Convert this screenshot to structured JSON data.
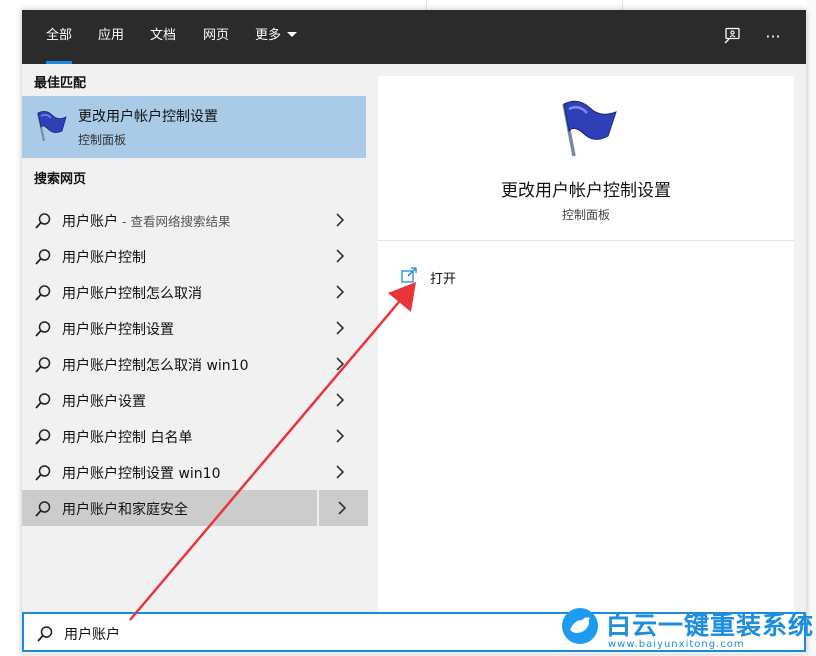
{
  "tabs": [
    {
      "label": "全部"
    },
    {
      "label": "应用"
    },
    {
      "label": "文档"
    },
    {
      "label": "网页"
    },
    {
      "label": "更多"
    }
  ],
  "top_icons": {
    "feedback": "feedback-icon",
    "more": "···"
  },
  "left": {
    "best_match_title": "最佳匹配",
    "best_match": {
      "title": "更改用户帐户控制设置",
      "subtitle": "控制面板",
      "icon": "flag-icon"
    },
    "web_title": "搜索网页",
    "web_results": [
      {
        "label": "用户账户",
        "hint": " - 查看网络搜索结果"
      },
      {
        "label": "用户账户控制",
        "hint": ""
      },
      {
        "label": "用户账户控制怎么取消",
        "hint": ""
      },
      {
        "label": "用户账户控制设置",
        "hint": ""
      },
      {
        "label": "用户账户控制怎么取消 win10",
        "hint": ""
      },
      {
        "label": "用户账户设置",
        "hint": ""
      },
      {
        "label": "用户账户控制 白名单",
        "hint": ""
      },
      {
        "label": "用户账户控制设置 win10",
        "hint": ""
      },
      {
        "label": "用户账户和家庭安全",
        "hint": ""
      }
    ]
  },
  "preview": {
    "title": "更改用户帐户控制设置",
    "subtitle": "控制面板",
    "open_label": "打开"
  },
  "search": {
    "value": "用户账户"
  },
  "watermark": {
    "text": "白云一键重装系统",
    "url": "www.baiyunxitong.com"
  },
  "colors": {
    "accent": "#1a8ce0",
    "selected": "#a9cbe8",
    "topbar": "#2b2b2b",
    "arrow": "#e8353b"
  }
}
